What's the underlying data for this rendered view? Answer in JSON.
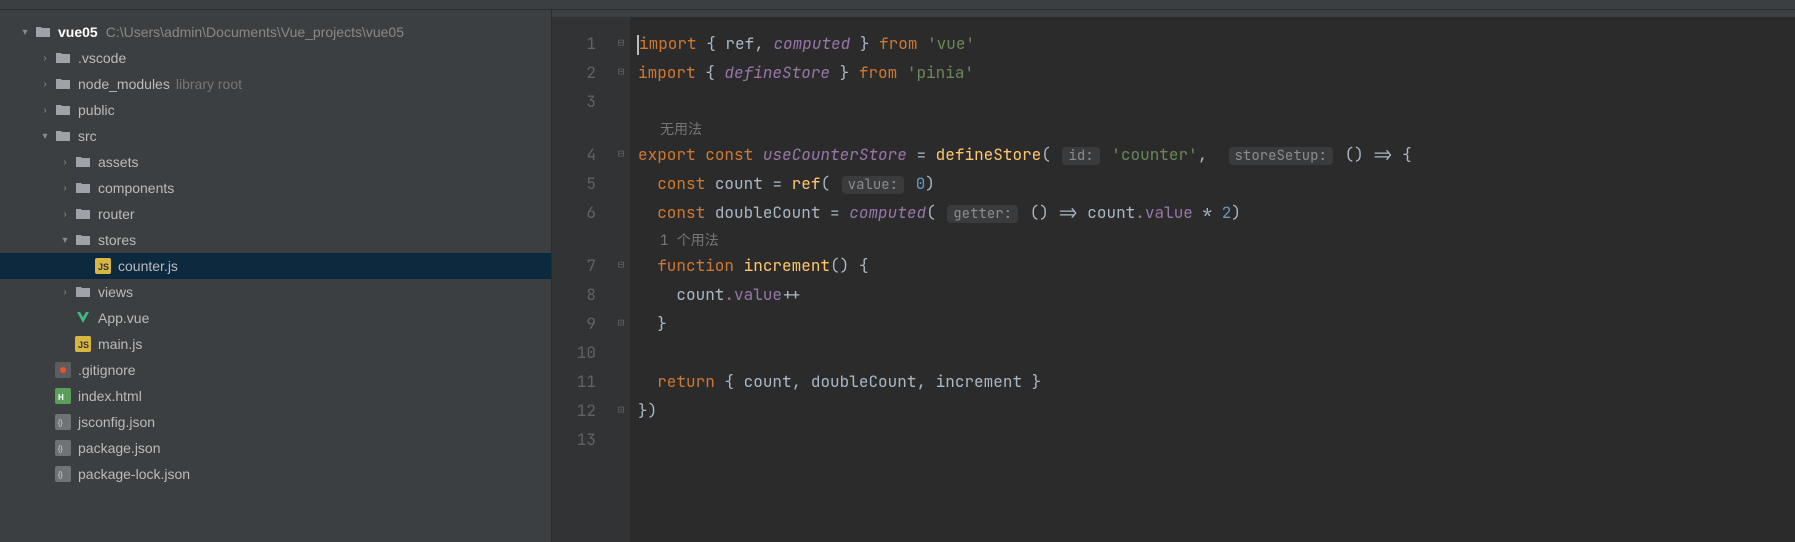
{
  "projectTree": {
    "root": {
      "name": "vue05",
      "path": "C:\\Users\\admin\\Documents\\Vue_projects\\vue05"
    },
    "nodes": [
      {
        "name": ".vscode",
        "type": "folder",
        "indent": 1,
        "collapsed": true
      },
      {
        "name": "node_modules",
        "type": "folder",
        "indent": 1,
        "collapsed": true,
        "suffix": "library root"
      },
      {
        "name": "public",
        "type": "folder",
        "indent": 1,
        "collapsed": true
      },
      {
        "name": "src",
        "type": "folder",
        "indent": 1,
        "collapsed": false
      },
      {
        "name": "assets",
        "type": "folder",
        "indent": 2,
        "collapsed": true
      },
      {
        "name": "components",
        "type": "folder",
        "indent": 2,
        "collapsed": true
      },
      {
        "name": "router",
        "type": "folder",
        "indent": 2,
        "collapsed": true
      },
      {
        "name": "stores",
        "type": "folder",
        "indent": 2,
        "collapsed": false
      },
      {
        "name": "counter.js",
        "type": "jsfile",
        "indent": 3,
        "selected": true
      },
      {
        "name": "views",
        "type": "folder",
        "indent": 2,
        "collapsed": true
      },
      {
        "name": "App.vue",
        "type": "vuefile",
        "indent": 2
      },
      {
        "name": "main.js",
        "type": "jsfile",
        "indent": 2
      },
      {
        "name": ".gitignore",
        "type": "gitfile",
        "indent": 1
      },
      {
        "name": "index.html",
        "type": "htmlfile",
        "indent": 1
      },
      {
        "name": "jsconfig.json",
        "type": "jsonfile",
        "indent": 1
      },
      {
        "name": "package.json",
        "type": "jsonfile",
        "indent": 1
      },
      {
        "name": "package-lock.json",
        "type": "jsonfile",
        "indent": 1
      }
    ]
  },
  "editor": {
    "inlay_usages_none": "无用法",
    "inlay_usages_one": "1 个用法",
    "lineNumbers": [
      "1",
      "2",
      "3",
      "4",
      "5",
      "6",
      "7",
      "8",
      "9",
      "10",
      "11",
      "12",
      "13"
    ],
    "tokens": {
      "import": "import",
      "from": "from",
      "ref": "ref",
      "computed": "computed",
      "vue": "'vue'",
      "defineStore": "defineStore",
      "pinia": "'pinia'",
      "export": "export",
      "const": "const",
      "useCounterStore": "useCounterStore",
      "id_hint": "id:",
      "counter": "'counter'",
      "storeSetup_hint": "storeSetup:",
      "count": "count",
      "ref_fn": "ref",
      "value_hint": "value:",
      "zero": "0",
      "doubleCount": "doubleCount",
      "computed_fn": "computed",
      "getter_hint": "getter:",
      "countvalue": "count",
      "dotvalue": ".value",
      "times2": " * ",
      "two": "2",
      "function": "function",
      "increment": "increment",
      "return": "return",
      "plusplus": "++"
    }
  }
}
